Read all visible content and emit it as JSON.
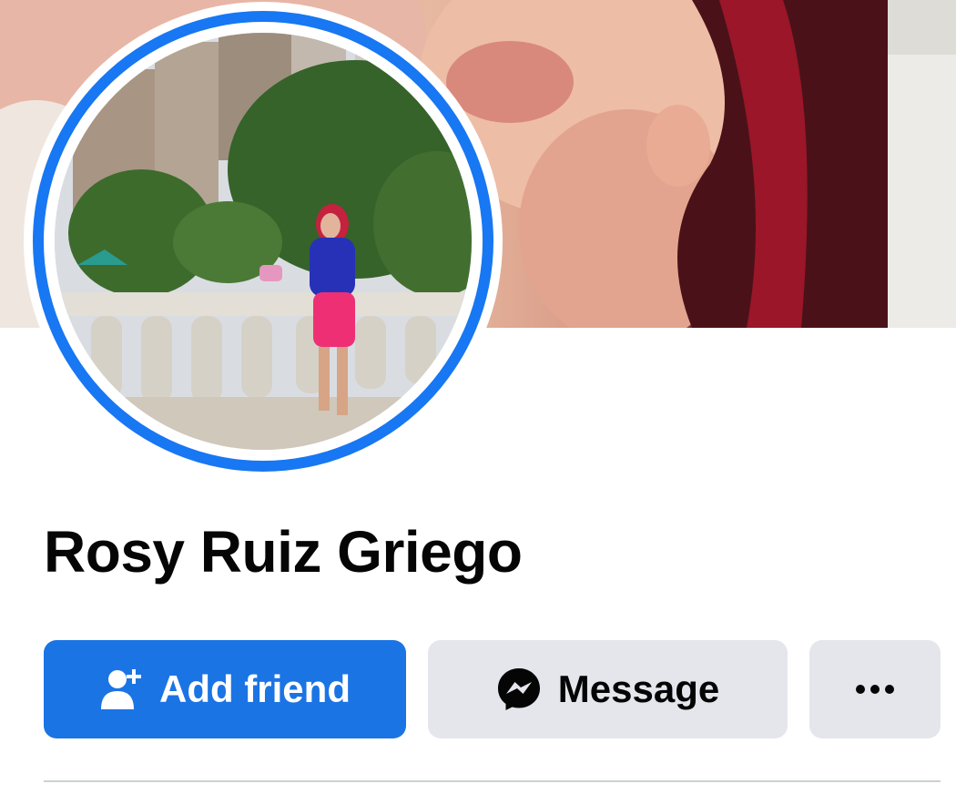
{
  "profile": {
    "name": "Rosy Ruiz Griego"
  },
  "actions": {
    "add_friend_label": "Add friend",
    "message_label": "Message",
    "more_icon": "more-dots-icon",
    "add_friend_icon": "add-person-icon",
    "message_icon": "messenger-icon"
  },
  "colors": {
    "primary": "#1b74e4",
    "avatar_ring": "#1877f2",
    "secondary_button": "#e4e6eb",
    "text": "#050505"
  }
}
